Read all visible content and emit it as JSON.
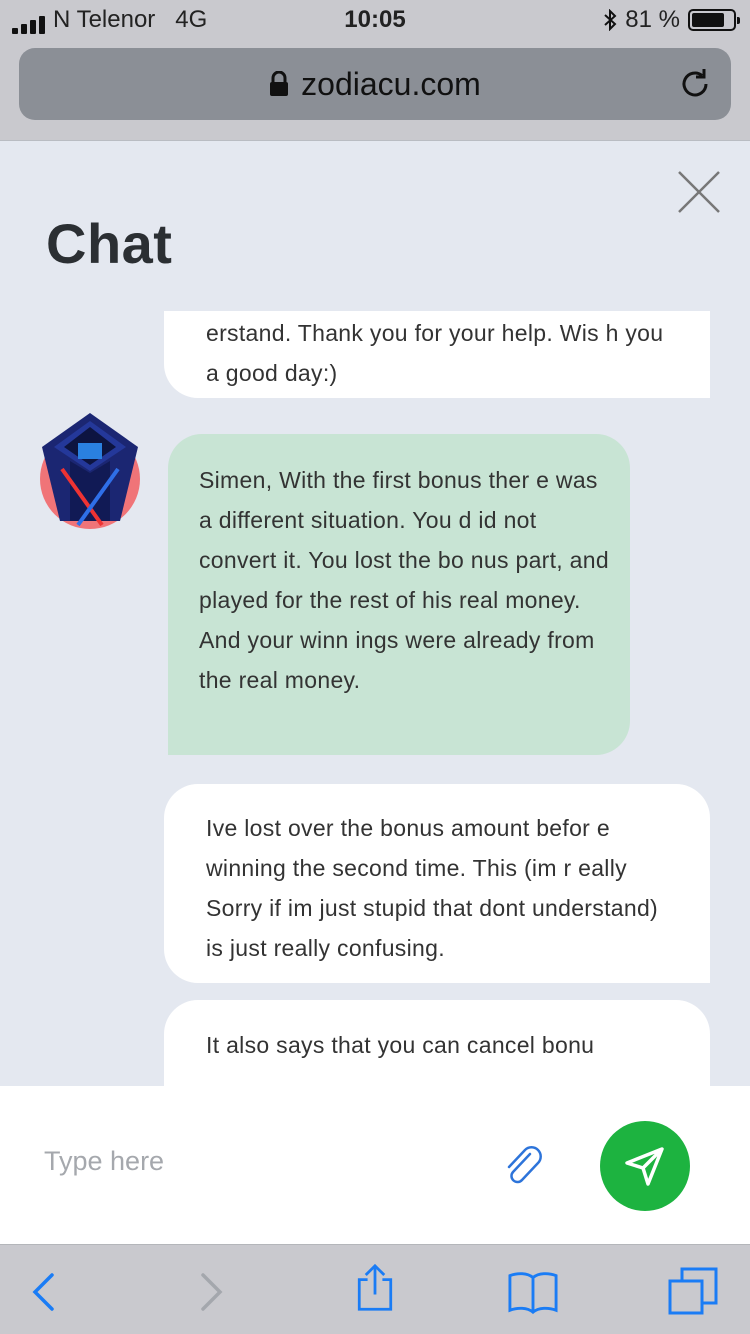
{
  "status_bar": {
    "carrier": "N Telenor",
    "network": "4G",
    "time": "10:05",
    "battery": "81 %",
    "battery_level": 0.81
  },
  "browser": {
    "url": "zodiacu.com"
  },
  "chat": {
    "title": "Chat",
    "messages": [
      {
        "sender": "user",
        "text": "erstand. Thank you for your help. Wis h you a good day:)"
      },
      {
        "sender": "agent",
        "text": "Simen, With the first bonus ther e was a different situation. You d id not convert it. You lost the bo nus part, and played for the rest of his real money. And your winn ings were already from the real money."
      },
      {
        "sender": "user",
        "text": "Ive lost over the bonus amount befor e winning the second time. This (im r eally Sorry if im just stupid that dont understand) is just really confusing."
      },
      {
        "sender": "user",
        "text": "It also says that you can cancel bonu"
      }
    ]
  },
  "composer": {
    "placeholder": "Type here"
  },
  "colors": {
    "chat_background": "#e4e8f0",
    "agent_bubble": "#c8e4d4",
    "user_bubble": "#ffffff",
    "send_button": "#1db340",
    "ios_blue": "#1a7cf5"
  },
  "icons": {
    "lock": "lock-icon",
    "reload": "reload-icon",
    "close": "close-icon",
    "attach": "paperclip-icon",
    "send": "send-icon",
    "back": "chevron-left-icon",
    "forward": "chevron-right-icon",
    "share": "share-icon",
    "bookmarks": "book-icon",
    "tabs": "tabs-icon"
  }
}
